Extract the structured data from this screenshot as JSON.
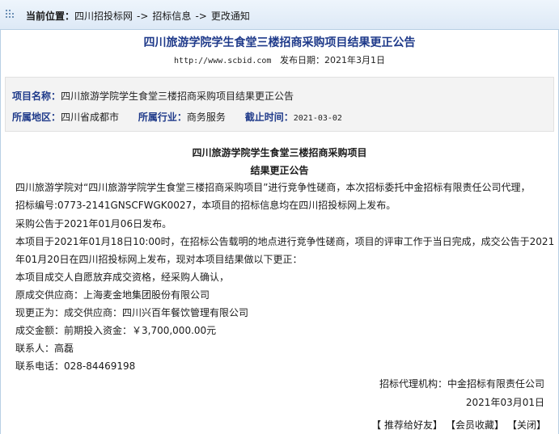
{
  "breadcrumb": {
    "label": "当前位置：",
    "items": [
      "四川招投标网",
      "招标信息",
      "更改通知"
    ],
    "separator": "->"
  },
  "article": {
    "title": "四川旅游学院学生食堂三楼招商采购项目结果更正公告",
    "url": "http://www.scbid.com",
    "publish_label": "发布日期：",
    "publish_date": "2021年3月1日"
  },
  "info": {
    "project_name_label": "项目名称：",
    "project_name": "四川旅游学院学生食堂三楼招商采购项目结果更正公告",
    "region_label": "所属地区：",
    "region": "四川省成都市",
    "industry_label": "所属行业：",
    "industry": "商务服务",
    "deadline_label": "截止时间：",
    "deadline": "2021-03-02"
  },
  "notice": {
    "heading1": "四川旅游学院学生食堂三楼招商采购项目",
    "heading2": "结果更正公告",
    "lines": [
      "四川旅游学院对“四川旅游学院学生食堂三楼招商采购项目”进行竞争性磋商，本次招标委托中金招标有限责任公司代理，",
      "招标编号:0773-2141GNSCFWGK0027，本项目的招标信息均在四川招投标网上发布。",
      "采购公告于2021年01月06日发布。",
      "本项目于2021年01月18日10:00时，在招标公告载明的地点进行竞争性磋商，项目的评审工作于当日完成，成交公告于2021",
      "年01月20日在四川招投标网上发布，现对本项目结果做以下更正：",
      "本项目成交人自愿放弃成交资格，经采购人确认，",
      "原成交供应商：上海麦金地集团股份有限公司",
      "现更正为：成交供应商：四川兴百年餐饮管理有限公司",
      "成交金额：前期投入资金：￥3,700,000.00元",
      "联系人：高磊",
      "联系电话：028-84469198"
    ],
    "agency": "招标代理机构：中金招标有限责任公司",
    "date": "2021年03月01日"
  },
  "footer": {
    "recommend": "【 推荐给好友】",
    "favorite": "【会员收藏】",
    "close": "【关闭】"
  }
}
